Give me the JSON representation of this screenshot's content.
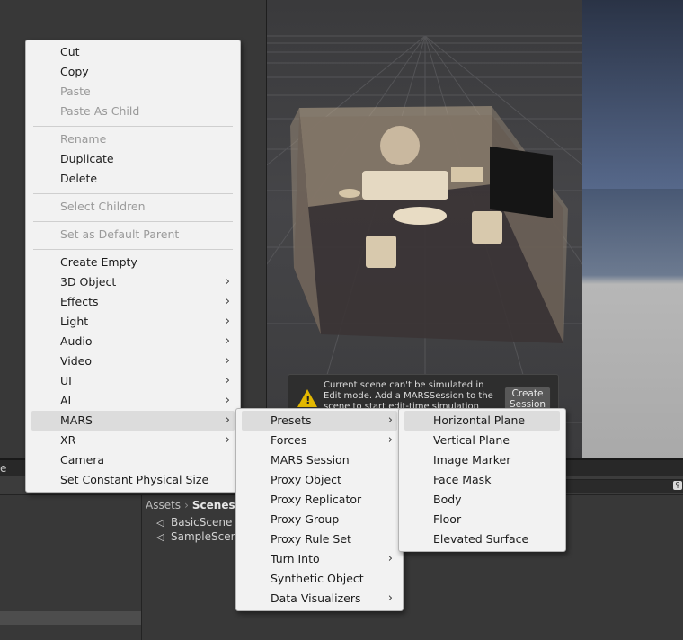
{
  "context_menu": {
    "items": [
      {
        "label": "Cut",
        "disabled": false
      },
      {
        "label": "Copy",
        "disabled": false
      },
      {
        "label": "Paste",
        "disabled": true
      },
      {
        "label": "Paste As Child",
        "disabled": true
      },
      {
        "label": "Rename",
        "disabled": true
      },
      {
        "label": "Duplicate",
        "disabled": false
      },
      {
        "label": "Delete",
        "disabled": false
      },
      {
        "label": "Select Children",
        "disabled": true
      },
      {
        "label": "Set as Default Parent",
        "disabled": true
      },
      {
        "label": "Create Empty",
        "disabled": false
      },
      {
        "label": "3D Object",
        "submenu": true
      },
      {
        "label": "Effects",
        "submenu": true
      },
      {
        "label": "Light",
        "submenu": true
      },
      {
        "label": "Audio",
        "submenu": true
      },
      {
        "label": "Video",
        "submenu": true
      },
      {
        "label": "UI",
        "submenu": true
      },
      {
        "label": "AI",
        "submenu": true
      },
      {
        "label": "MARS",
        "submenu": true,
        "highlighted": true
      },
      {
        "label": "XR",
        "submenu": true
      },
      {
        "label": "Camera",
        "disabled": false
      },
      {
        "label": "Set Constant Physical Size",
        "disabled": false
      }
    ]
  },
  "mars_menu": {
    "items": [
      {
        "label": "Presets",
        "submenu": true,
        "highlighted": true
      },
      {
        "label": "Forces",
        "submenu": true
      },
      {
        "label": "MARS Session"
      },
      {
        "label": "Proxy Object"
      },
      {
        "label": "Proxy Replicator"
      },
      {
        "label": "Proxy Group"
      },
      {
        "label": "Proxy Rule Set"
      },
      {
        "label": "Turn Into",
        "submenu": true
      },
      {
        "label": "Synthetic Object"
      },
      {
        "label": "Data Visualizers",
        "submenu": true
      }
    ]
  },
  "presets_menu": {
    "items": [
      {
        "label": "Horizontal Plane",
        "highlighted": true
      },
      {
        "label": "Vertical Plane"
      },
      {
        "label": "Image Marker"
      },
      {
        "label": "Face Mask"
      },
      {
        "label": "Body"
      },
      {
        "label": "Floor"
      },
      {
        "label": "Elevated Surface"
      }
    ]
  },
  "scene_notice": {
    "message": "Current scene can't be simulated in Edit mode. Add a MARSSession to the scene to start edit-time simulation (Create ->",
    "button_label": "Create Session"
  },
  "project": {
    "tab_fragment": "e",
    "breadcrumb": [
      "Assets",
      "Scenes"
    ],
    "files": [
      "BasicScene",
      "SampleScen"
    ]
  },
  "icons": {
    "submenu_arrow": "chevron-right-icon",
    "warning": "warning-icon",
    "scene": "unity-scene-icon",
    "search": "search-icon"
  },
  "colors": {
    "menu_bg": "#f2f2f2",
    "menu_highlight": "#dcdcdc",
    "editor_bg": "#383838",
    "warning": "#e3b800"
  }
}
